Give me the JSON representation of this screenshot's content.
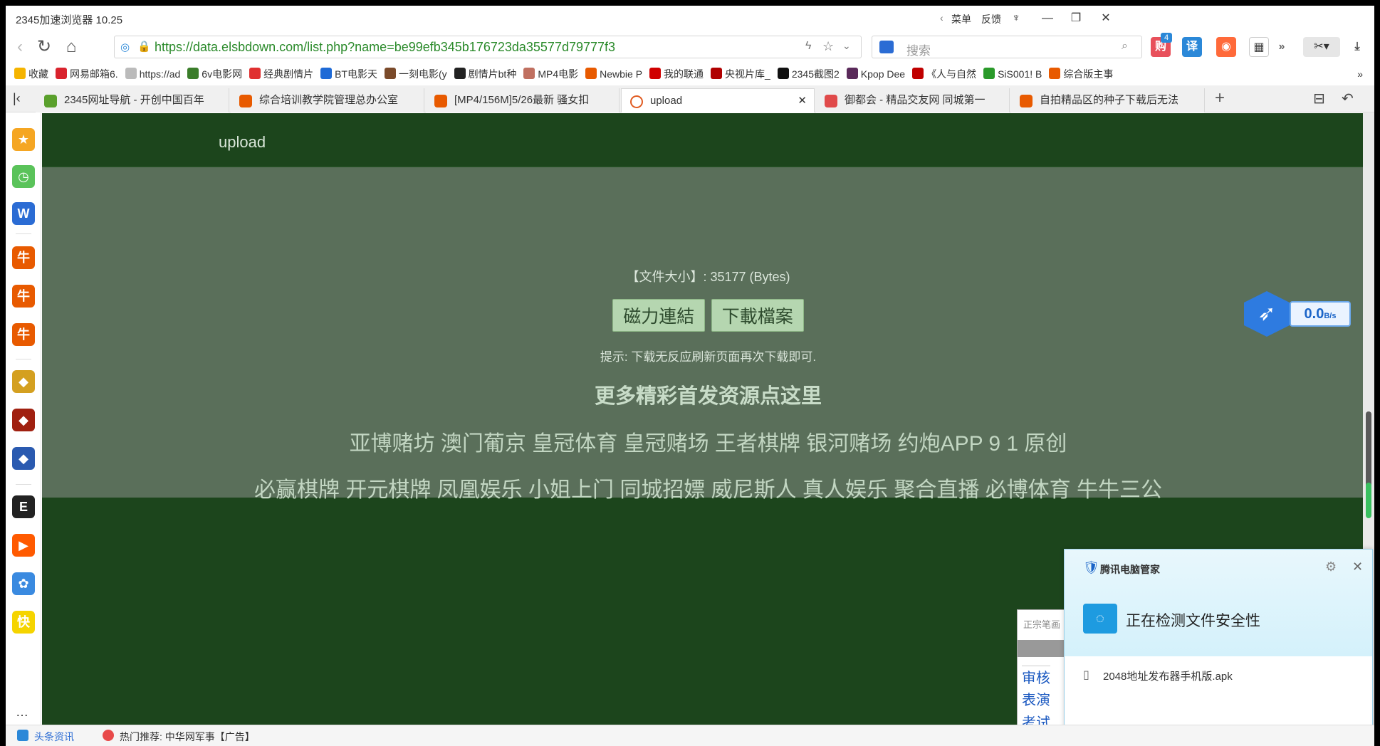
{
  "window": {
    "app_title": "2345加速浏览器 10.25",
    "menu_label": "菜单",
    "feedback_label": "反馈"
  },
  "address_bar": {
    "url": "https://data.elsbdown.com/list.php?name=be99efb345b176723da35577d79777f3",
    "search_placeholder": "搜索",
    "badge_count": "4"
  },
  "bookmarks": [
    {
      "label": "收藏",
      "icon": "star-icon",
      "color": "#f5b400"
    },
    {
      "label": "网易邮箱6.",
      "icon": "netease-mail-icon",
      "color": "#d9232d"
    },
    {
      "label": "https://ad",
      "icon": "page-icon",
      "color": "#bbbbbb"
    },
    {
      "label": "6v电影网",
      "icon": "movie-icon",
      "color": "#3a7d2a"
    },
    {
      "label": "经典剧情片",
      "icon": "video-icon",
      "color": "#e03030"
    },
    {
      "label": "BT电影天",
      "icon": "bt-icon",
      "color": "#1e6ad6"
    },
    {
      "label": "一刻电影(y",
      "icon": "film-icon",
      "color": "#7a4a2a"
    },
    {
      "label": "剧情片bt种",
      "icon": "play-icon",
      "color": "#222222"
    },
    {
      "label": "MP4电影",
      "icon": "mp4-icon",
      "color": "#c07060"
    },
    {
      "label": "Newbie P",
      "icon": "newbie-icon",
      "color": "#e85a00"
    },
    {
      "label": "我的联通",
      "icon": "unicom-icon",
      "color": "#d00000"
    },
    {
      "label": "央视片库_",
      "icon": "cctv-icon",
      "color": "#b00000"
    },
    {
      "label": "2345截图2",
      "icon": "cloud-icon",
      "color": "#111111"
    },
    {
      "label": "Kpop Dee",
      "icon": "kpop-icon",
      "color": "#5a2a5a"
    },
    {
      "label": "《人与自然",
      "icon": "cctv-icon",
      "color": "#c00000"
    },
    {
      "label": "SiS001! B",
      "icon": "tree-icon",
      "color": "#2a9a2a"
    },
    {
      "label": "综合版主事",
      "icon": "newbie-icon",
      "color": "#e85a00"
    }
  ],
  "tabs": [
    {
      "label": "2345网址导航 - 开创中国百年",
      "color": "#5aa02c",
      "active": false
    },
    {
      "label": "综合培训教学院管理总办公室",
      "color": "#e85a00",
      "active": false
    },
    {
      "label": "[MP4/156M]5/26最新 骚女扣",
      "color": "#e85a00",
      "active": false
    },
    {
      "label": "upload",
      "color": "#ffffff",
      "active": true
    },
    {
      "label": "御都会 - 精品交友网 同城第一",
      "color": "#e04a4a",
      "active": false
    },
    {
      "label": "自拍精品区的种子下载后无法",
      "color": "#e85a00",
      "active": false
    }
  ],
  "sidebar": [
    {
      "icon": "favorites-icon",
      "color": "#f5a623",
      "glyph": "★"
    },
    {
      "icon": "history-icon",
      "color": "#5ac35a",
      "glyph": "◷"
    },
    {
      "icon": "word-doc-icon",
      "color": "#2b6cd4",
      "glyph": "W"
    },
    {
      "icon": "newbie-icon",
      "color": "#e85a00",
      "glyph": "牛"
    },
    {
      "icon": "newbie-icon",
      "color": "#e85a00",
      "glyph": "牛"
    },
    {
      "icon": "newbie-icon",
      "color": "#e85a00",
      "glyph": "牛"
    },
    {
      "icon": "game-icon",
      "color": "#d4a020",
      "glyph": "◆"
    },
    {
      "icon": "game-icon",
      "color": "#a02010",
      "glyph": "◆"
    },
    {
      "icon": "game-icon",
      "color": "#2a5ab0",
      "glyph": "◆"
    },
    {
      "icon": "font-icon",
      "color": "#222222",
      "glyph": "E"
    },
    {
      "icon": "video-app-icon",
      "color": "#ff5a00",
      "glyph": "▶"
    },
    {
      "icon": "baidu-netdisk-icon",
      "color": "#3a8ae0",
      "glyph": "✿"
    },
    {
      "icon": "kuaishou-icon",
      "color": "#f5d400",
      "glyph": "快"
    }
  ],
  "page": {
    "site_title": "upload",
    "file_size": "【文件大小】: 35177 (Bytes)",
    "magnet_button": "磁力連結",
    "download_button": "下載檔案",
    "tip": "提示: 下载无反应刷新页面再次下载即可.",
    "more_link": "更多精彩首发资源点这里",
    "ads_line1": "亚博赌坊 澳门葡京 皇冠体育 皇冠赌场 王者棋牌 银河赌场 约炮APP 9 1 原创",
    "ads_line2": "必赢棋牌 开元棋牌 凤凰娱乐 小姐上门 同城招嫖 威尼斯人 真人娱乐 聚合直播 必博体育 牛牛三公"
  },
  "speed_widget": {
    "value": "0.0",
    "unit": "B/s"
  },
  "partial_popup": {
    "title": "正宗笔画",
    "rows": [
      "审核",
      "表演",
      "考试"
    ]
  },
  "security_popup": {
    "brand": "腾讯电脑管家",
    "message": "正在检测文件安全性",
    "file_name": "2048地址发布器手机版.apk"
  },
  "status_bar": {
    "news_label": "头条资讯",
    "hot_label": "热门推荐: 中华网军事【广告】"
  }
}
